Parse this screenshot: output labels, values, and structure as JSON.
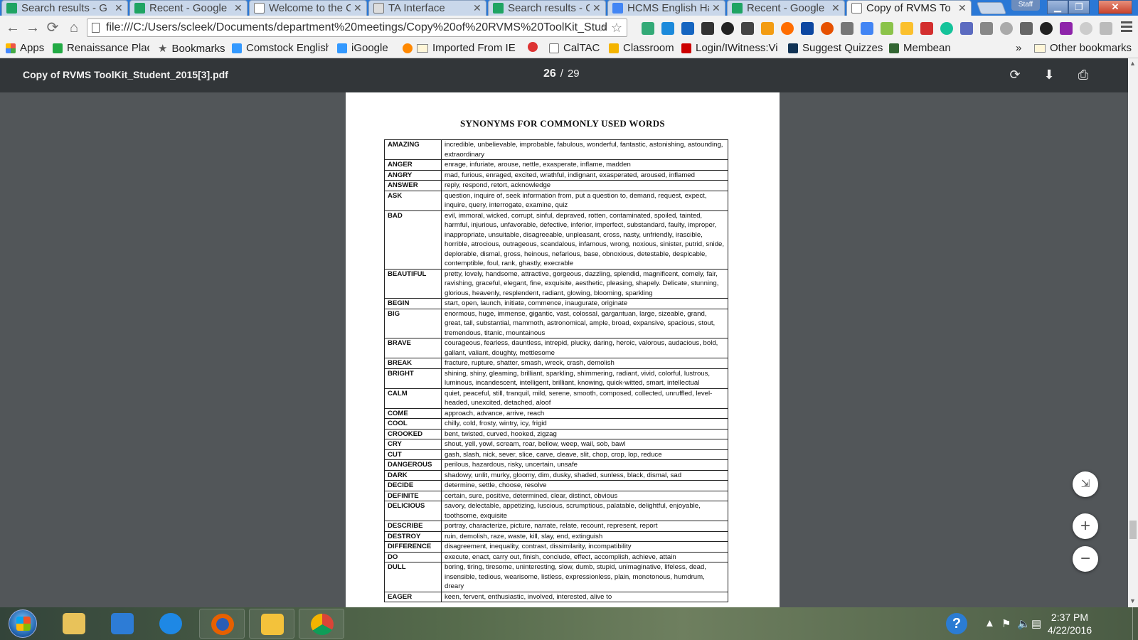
{
  "tabs": [
    {
      "title": "Search results - G",
      "color": "#1fa463"
    },
    {
      "title": "Recent - Google",
      "color": "#1fa463"
    },
    {
      "title": "Welcome to the C",
      "color": "#ffffff"
    },
    {
      "title": "TA Interface",
      "color": "#dddddd"
    },
    {
      "title": "Search results - G",
      "color": "#1fa463"
    },
    {
      "title": "HCMS English Ha",
      "color": "#4285f4"
    },
    {
      "title": "Recent - Google",
      "color": "#1fa463"
    },
    {
      "title": "Copy of RVMS To",
      "color": "#ffffff"
    }
  ],
  "staff_label": "Staff",
  "url": "file:///C:/Users/scleek/Documents/department%20meetings/Copy%20of%20RVMS%20ToolKit_Stud",
  "bookmarks": [
    {
      "label": "Apps",
      "color": "#e54"
    },
    {
      "label": "Renaissance Place",
      "color": "#2a4"
    },
    {
      "label": "Bookmarks",
      "color": "#555"
    },
    {
      "label": "Comstock English",
      "color": "#39f"
    },
    {
      "label": "iGoogle",
      "color": "#39f"
    },
    {
      "label": "Imported From IE",
      "color": "#f80"
    },
    {
      "label": "",
      "color": "#d33"
    },
    {
      "label": "CalTAC",
      "color": "#ddd"
    },
    {
      "label": "Classroom",
      "color": "#f4b400"
    },
    {
      "label": "Login/IWitness:Vi",
      "color": "#c00"
    },
    {
      "label": "Suggest Quizzes",
      "color": "#135"
    },
    {
      "label": "Membean",
      "color": "#363"
    }
  ],
  "overflow_chevron": "»",
  "other_bookmarks": "Other bookmarks",
  "pdf": {
    "filename": "Copy of RVMS ToolKit_Student_2015[3].pdf",
    "current_page": "26",
    "total_pages": "29",
    "separator": "/"
  },
  "document": {
    "title": "SYNONYMS FOR COMMONLY USED WORDS",
    "rows": [
      {
        "word": "AMAZING",
        "synonyms": "incredible, unbelievable, improbable, fabulous, wonderful, fantastic, astonishing, astounding, extraordinary"
      },
      {
        "word": "ANGER",
        "synonyms": "enrage, infuriate, arouse, nettle, exasperate, inflame, madden"
      },
      {
        "word": "ANGRY",
        "synonyms": "mad, furious, enraged, excited, wrathful, indignant, exasperated, aroused, inflamed"
      },
      {
        "word": "ANSWER",
        "synonyms": "reply, respond, retort, acknowledge"
      },
      {
        "word": "ASK",
        "synonyms": "question, inquire of, seek information from, put a question to, demand, request, expect, inquire, query, interrogate, examine, quiz"
      },
      {
        "word": "BAD",
        "synonyms": "evil, immoral, wicked, corrupt, sinful, depraved, rotten, contaminated, spoiled, tainted, harmful, injurious, unfavorable, defective, inferior, imperfect, substandard, faulty, improper, inappropriate, unsuitable, disagreeable, unpleasant, cross, nasty, unfriendly, irascible, horrible, atrocious, outrageous, scandalous, infamous, wrong, noxious, sinister, putrid, snide, deplorable, dismal, gross, heinous, nefarious, base, obnoxious, detestable, despicable, contemptible, foul, rank, ghastly, execrable"
      },
      {
        "word": "BEAUTIFUL",
        "synonyms": "pretty, lovely, handsome, attractive, gorgeous, dazzling, splendid, magnificent, comely, fair, ravishing, graceful, elegant, fine, exquisite, aesthetic, pleasing, shapely. Delicate, stunning, glorious, heavenly, resplendent, radiant, glowing, blooming, sparkling"
      },
      {
        "word": "BEGIN",
        "synonyms": "start, open, launch, initiate, commence, inaugurate, originate"
      },
      {
        "word": "BIG",
        "synonyms": "enormous, huge, immense, gigantic, vast, colossal, gargantuan, large, sizeable, grand, great, tall, substantial, mammoth, astronomical, ample, broad, expansive, spacious, stout, tremendous, titanic, mountainous"
      },
      {
        "word": "BRAVE",
        "synonyms": "courageous, fearless, dauntless, intrepid, plucky, daring, heroic, valorous, audacious, bold, gallant, valiant, doughty, mettlesome"
      },
      {
        "word": "BREAK",
        "synonyms": "fracture, rupture, shatter, smash, wreck, crash, demolish"
      },
      {
        "word": "BRIGHT",
        "synonyms": "shining, shiny, gleaming, brilliant, sparkling, shimmering, radiant, vivid, colorful, lustrous, luminous, incandescent, intelligent, brilliant, knowing, quick-witted, smart, intellectual"
      },
      {
        "word": "CALM",
        "synonyms": "quiet, peaceful, still, tranquil, mild, serene, smooth, composed, collected, unruffled, level-headed, unexcited, detached, aloof"
      },
      {
        "word": "COME",
        "synonyms": "approach, advance, arrive, reach"
      },
      {
        "word": "COOL",
        "synonyms": "chilly, cold, frosty, wintry, icy, frigid"
      },
      {
        "word": "CROOKED",
        "synonyms": "bent, twisted, curved, hooked, zigzag"
      },
      {
        "word": "CRY",
        "synonyms": "shout, yell, yowl, scream, roar, bellow, weep, wail, sob, bawl"
      },
      {
        "word": "CUT",
        "synonyms": "gash, slash, nick, sever, slice, carve, cleave, slit, chop, crop, lop, reduce"
      },
      {
        "word": "DANGEROUS",
        "synonyms": "perilous, hazardous, risky, uncertain, unsafe"
      },
      {
        "word": "DARK",
        "synonyms": "shadowy, unlit, murky, gloomy, dim, dusky, shaded, sunless, black, dismal, sad"
      },
      {
        "word": "DECIDE",
        "synonyms": "determine, settle, choose, resolve"
      },
      {
        "word": "DEFINITE",
        "synonyms": "certain, sure, positive, determined, clear, distinct, obvious"
      },
      {
        "word": "DELICIOUS",
        "synonyms": "savory, delectable, appetizing, luscious, scrumptious, palatable, delightful, enjoyable, toothsome, exquisite"
      },
      {
        "word": "DESCRIBE",
        "synonyms": "portray, characterize, picture, narrate, relate, recount, represent, report"
      },
      {
        "word": "DESTROY",
        "synonyms": "ruin, demolish, raze, waste, kill, slay, end, extinguish"
      },
      {
        "word": "DIFFERENCE",
        "synonyms": "disagreement, inequality, contrast, dissimilarity, incompatibility"
      },
      {
        "word": "DO",
        "synonyms": "execute, enact, carry out, finish, conclude, effect, accomplish, achieve, attain"
      },
      {
        "word": "DULL",
        "synonyms": "boring, tiring, tiresome, uninteresting, slow, dumb, stupid, unimaginative, lifeless, dead, insensible, tedious, wearisome, listless, expressionless, plain, monotonous, humdrum, dreary"
      },
      {
        "word": "EAGER",
        "synonyms": "keen, fervent, enthusiastic, involved, interested, alive to"
      }
    ]
  },
  "fab": {
    "fit": "⇲",
    "zoom_in": "+",
    "zoom_out": "−"
  },
  "clock": {
    "time": "2:37 PM",
    "date": "4/22/2016"
  },
  "help_label": "?"
}
